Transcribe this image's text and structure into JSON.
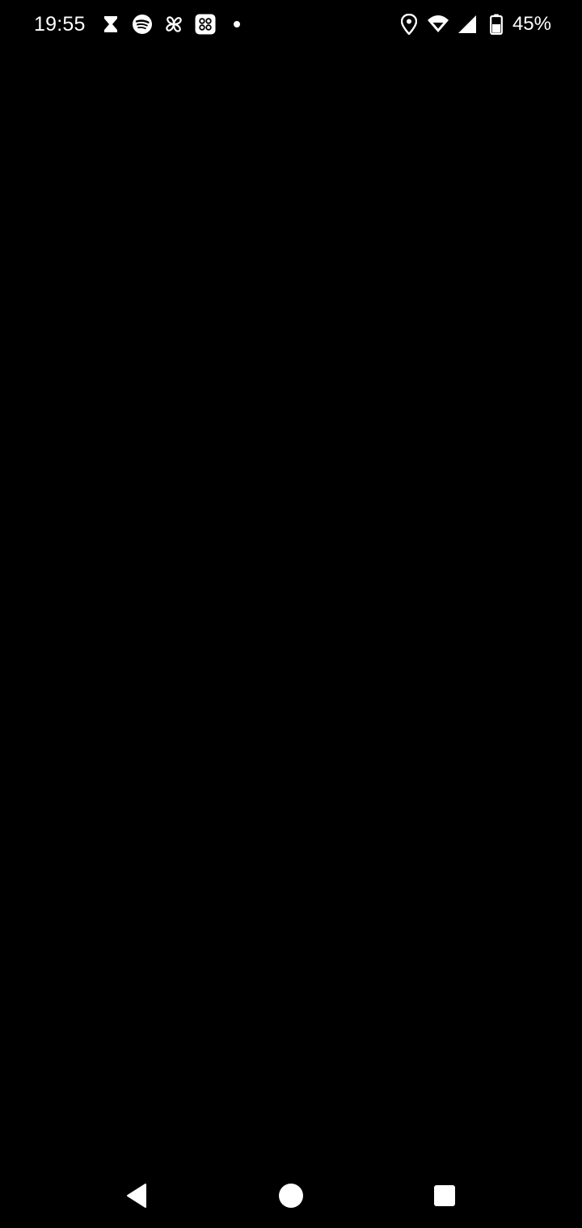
{
  "status_bar": {
    "time": "19:55",
    "left_icons": [
      "hourglass-icon",
      "spotify-icon",
      "pinwheel-icon",
      "apps-grid-icon",
      "notification-dot-icon"
    ],
    "right_icons": [
      "location-icon",
      "wifi-icon",
      "cell-signal-icon",
      "battery-icon"
    ],
    "battery_percent": "45%"
  },
  "navigation_bar": {
    "buttons": [
      "back",
      "home",
      "recents"
    ]
  },
  "colors": {
    "background": "#000000",
    "foreground": "#ffffff"
  }
}
